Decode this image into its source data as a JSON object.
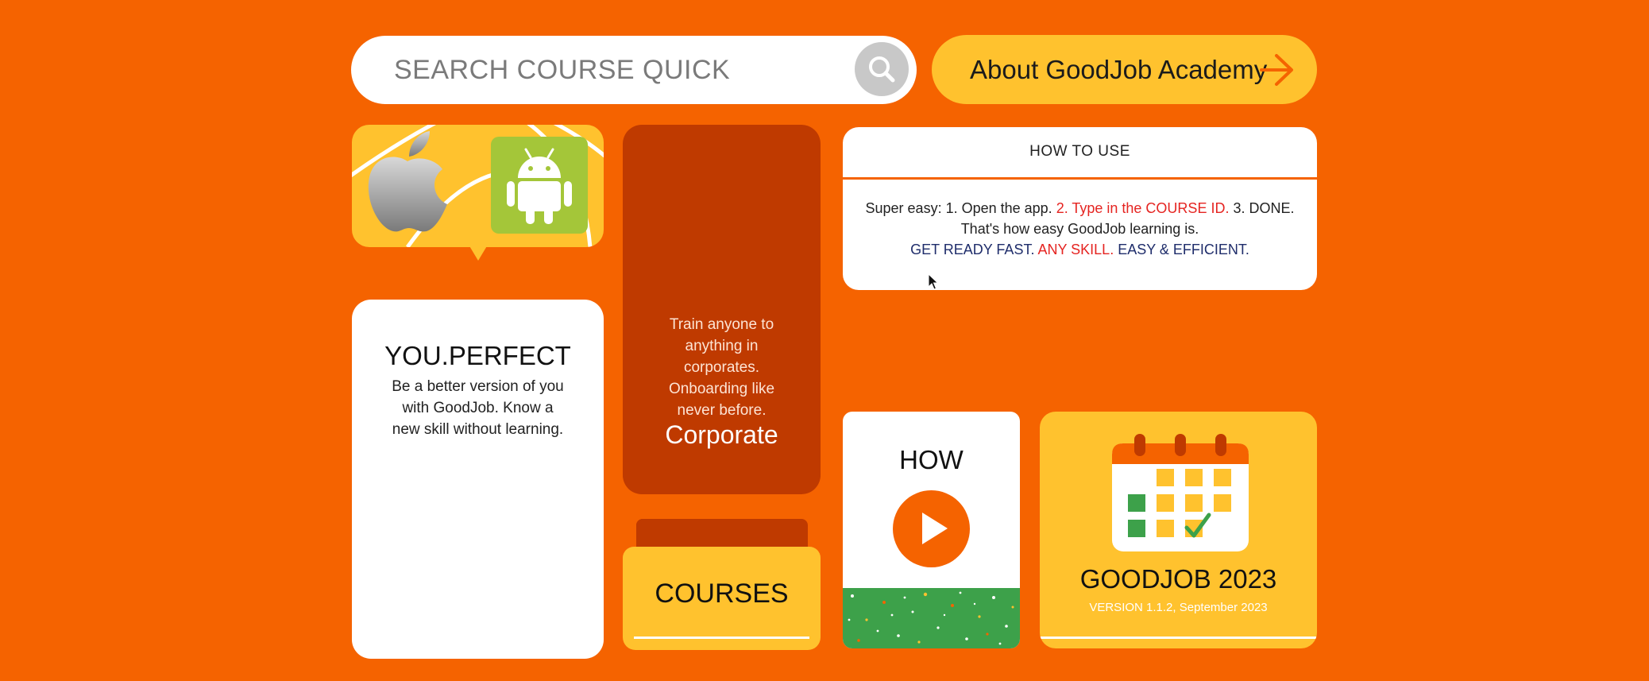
{
  "search": {
    "placeholder": "SEARCH COURSE QUICK",
    "icon": "search-icon"
  },
  "about": {
    "label": "About GoodJob Academy",
    "icon": "arrow-right-icon"
  },
  "app_tile": {
    "icons": [
      "apple-logo-icon",
      "android-logo-icon"
    ]
  },
  "perfect_card": {
    "title": "YOU.PERFECT",
    "body": "Be a better version of you with GoodJob. Know a new skill without learning."
  },
  "corporate_card": {
    "body": "Train anyone to anything in corporates. Onboarding like never before.",
    "title": "Corporate"
  },
  "courses_card": {
    "label": "COURSES",
    "icon": "folder-icon"
  },
  "how_to_use": {
    "title": "HOW TO USE",
    "line1_a": "Super easy: 1. Open the app. ",
    "line1_b": "2. Type in the COURSE ID.",
    "line1_c": " 3. DONE.",
    "line2": "That's how easy GoodJob learning is.",
    "line3_a": "GET READY FAST. ",
    "line3_b": "ANY SKILL.",
    "line3_c": " EASY & EFFICIENT."
  },
  "how_card": {
    "title": "HOW",
    "icon": "play-icon"
  },
  "goodjob_card": {
    "title": "GOODJOB 2023",
    "version": "VERSION 1.1.2, September 2023",
    "icon": "calendar-icon"
  },
  "colors": {
    "background": "#F56300",
    "yellow": "#FFC22E",
    "dark_orange": "#BF3A00",
    "red": "#E52421",
    "navy": "#1F2D6B",
    "green": "#3DA14A",
    "android_green": "#A4C639"
  }
}
